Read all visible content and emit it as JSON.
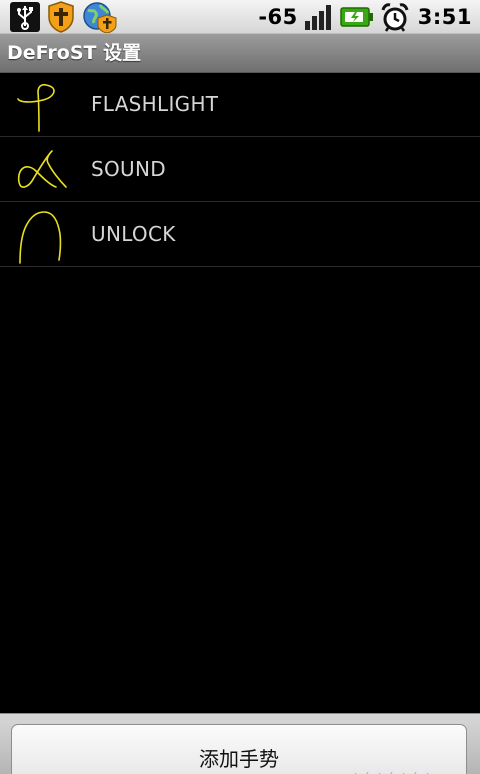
{
  "status_bar": {
    "signal_strength": "-65",
    "time": "3:51",
    "icons": [
      "usb-icon",
      "shield-cross-icon",
      "globe-shield-icon",
      "signal-bars-icon",
      "battery-charging-icon",
      "alarm-clock-icon"
    ]
  },
  "title_bar": {
    "title": "DeFroST 设置"
  },
  "gestures": [
    {
      "label": "FLASHLIGHT",
      "icon": "gesture-p-icon",
      "stroke_color": "#e8e020"
    },
    {
      "label": "SOUND",
      "icon": "gesture-alpha-icon",
      "stroke_color": "#e8e020"
    },
    {
      "label": "UNLOCK",
      "icon": "gesture-arch-icon",
      "stroke_color": "#e8e020"
    }
  ],
  "bottom_bar": {
    "add_button_label": "添加手势"
  },
  "colors": {
    "background": "#000000",
    "title_bar": "#8a8a8a",
    "list_text": "#d6d6d6",
    "gesture_stroke": "#e8e020",
    "battery": "#39a812"
  }
}
